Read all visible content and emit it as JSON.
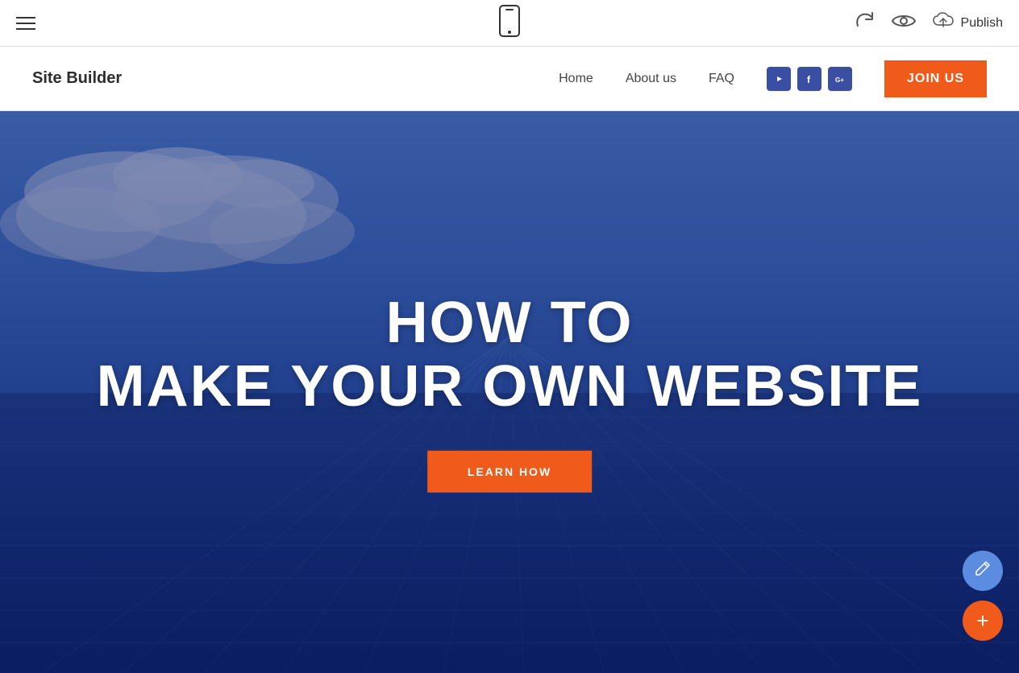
{
  "toolbar": {
    "hamburger_label": "menu",
    "mobile_icon_label": "📱",
    "undo_label": "↩",
    "eye_label": "👁",
    "publish_label": "Publish",
    "cloud_upload_label": "☁"
  },
  "site_nav": {
    "logo": "Site Builder",
    "nav_links": [
      {
        "id": "home",
        "label": "Home"
      },
      {
        "id": "about",
        "label": "About us"
      },
      {
        "id": "faq",
        "label": "FAQ"
      }
    ],
    "join_button": "JOIN US",
    "social_icons": [
      {
        "id": "youtube",
        "label": "▶",
        "title": "YouTube"
      },
      {
        "id": "facebook",
        "label": "f",
        "title": "Facebook"
      },
      {
        "id": "google",
        "label": "G+",
        "title": "Google+"
      }
    ]
  },
  "hero": {
    "title_line1": "HOW TO",
    "title_line2": "MAKE YOUR OWN WEBSITE",
    "cta_button": "LEARN HOW"
  },
  "fab": {
    "edit_icon": "✏",
    "add_icon": "+"
  },
  "colors": {
    "accent_orange": "#f05a1a",
    "nav_blue": "#3a4fa3",
    "hero_overlay": "rgba(30,50,120,0.6)"
  }
}
